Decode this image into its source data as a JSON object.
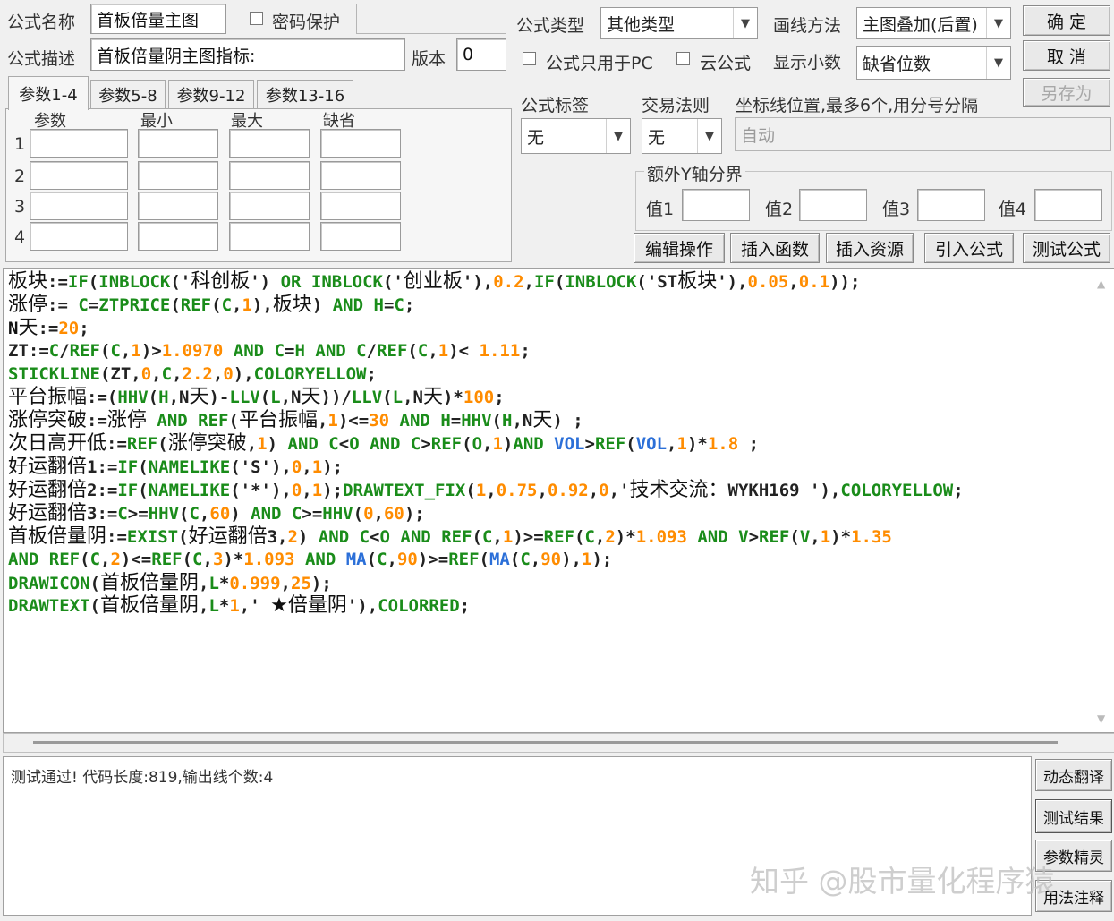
{
  "header": {
    "formula_name_label": "公式名称",
    "formula_name_value": "首板倍量主图",
    "password_protect_label": "密码保护",
    "formula_desc_label": "公式描述",
    "formula_desc_value": "首板倍量阴主图指标:",
    "version_label": "版本",
    "version_value": "0",
    "formula_type_label": "公式类型",
    "formula_type_value": "其他类型",
    "draw_method_label": "画线方法",
    "draw_method_value": "主图叠加(后置)",
    "pc_only_label": "公式只用于PC",
    "cloud_label": "云公式",
    "decimals_label": "显示小数",
    "decimals_value": "缺省位数",
    "tag_label": "公式标签",
    "tag_value": "无",
    "trade_rule_label": "交易法则",
    "trade_rule_value": "无",
    "axis_label": "坐标线位置,最多6个,用分号分隔",
    "axis_placeholder": "自动",
    "extra_y_label": "额外Y轴分界",
    "y_vals": [
      "值1",
      "值2",
      "值3",
      "值4"
    ]
  },
  "buttons": {
    "ok": "确  定",
    "cancel": "取  消",
    "save_as": "另存为",
    "edit_ops": "编辑操作",
    "insert_func": "插入函数",
    "insert_res": "插入资源",
    "import_formula": "引入公式",
    "test_formula": "测试公式",
    "dyn_translate": "动态翻译",
    "test_result": "测试结果",
    "param_wizard": "参数精灵",
    "usage_notes": "用法注释"
  },
  "params": {
    "tabs": [
      "参数1-4",
      "参数5-8",
      "参数9-12",
      "参数13-16"
    ],
    "columns": [
      "参数",
      "最小",
      "最大",
      "缺省"
    ],
    "rows": [
      "1",
      "2",
      "3",
      "4"
    ]
  },
  "code_lines": [
    [
      [
        "d",
        "板块"
      ],
      [
        "c",
        ":="
      ],
      [
        "k",
        "IF"
      ],
      [
        "c",
        "("
      ],
      [
        "k",
        "INBLOCK"
      ],
      [
        "c",
        "('"
      ],
      [
        "d",
        "科创板"
      ],
      [
        "c",
        "') "
      ],
      [
        "k",
        "OR"
      ],
      [
        "c",
        " "
      ],
      [
        "k",
        "INBLOCK"
      ],
      [
        "c",
        "('"
      ],
      [
        "d",
        "创业板"
      ],
      [
        "c",
        "'),"
      ],
      [
        "n",
        "0.2"
      ],
      [
        "c",
        ","
      ],
      [
        "k",
        "IF"
      ],
      [
        "c",
        "("
      ],
      [
        "k",
        "INBLOCK"
      ],
      [
        "c",
        "('ST"
      ],
      [
        "d",
        "板块"
      ],
      [
        "c",
        "'),"
      ],
      [
        "n",
        "0.05"
      ],
      [
        "c",
        ","
      ],
      [
        "n",
        "0.1"
      ],
      [
        "c",
        "));"
      ]
    ],
    [
      [
        "d",
        "涨停"
      ],
      [
        "c",
        ":= "
      ],
      [
        "k",
        "C"
      ],
      [
        "c",
        "="
      ],
      [
        "k",
        "ZTPRICE"
      ],
      [
        "c",
        "("
      ],
      [
        "k",
        "REF"
      ],
      [
        "c",
        "("
      ],
      [
        "k",
        "C"
      ],
      [
        "c",
        ","
      ],
      [
        "n",
        "1"
      ],
      [
        "c",
        "),"
      ],
      [
        "d",
        "板块"
      ],
      [
        "c",
        ") "
      ],
      [
        "k",
        "AND"
      ],
      [
        "c",
        " "
      ],
      [
        "k",
        "H"
      ],
      [
        "c",
        "="
      ],
      [
        "k",
        "C"
      ],
      [
        "c",
        ";"
      ]
    ],
    [
      [
        "s",
        "N"
      ],
      [
        "d",
        "天"
      ],
      [
        "c",
        ":="
      ],
      [
        "n",
        "20"
      ],
      [
        "c",
        ";"
      ]
    ],
    [
      [
        "c",
        "ZT:="
      ],
      [
        "k",
        "C"
      ],
      [
        "c",
        "/"
      ],
      [
        "k",
        "REF"
      ],
      [
        "c",
        "("
      ],
      [
        "k",
        "C"
      ],
      [
        "c",
        ","
      ],
      [
        "n",
        "1"
      ],
      [
        "c",
        ")>"
      ],
      [
        "n",
        "1.0970"
      ],
      [
        "c",
        " "
      ],
      [
        "k",
        "AND"
      ],
      [
        "c",
        " "
      ],
      [
        "k",
        "C"
      ],
      [
        "c",
        "="
      ],
      [
        "k",
        "H"
      ],
      [
        "c",
        " "
      ],
      [
        "k",
        "AND"
      ],
      [
        "c",
        " "
      ],
      [
        "k",
        "C"
      ],
      [
        "c",
        "/"
      ],
      [
        "k",
        "REF"
      ],
      [
        "c",
        "("
      ],
      [
        "k",
        "C"
      ],
      [
        "c",
        ","
      ],
      [
        "n",
        "1"
      ],
      [
        "c",
        ")< "
      ],
      [
        "n",
        "1.11"
      ],
      [
        "c",
        ";"
      ]
    ],
    [
      [
        "k",
        "STICKLINE"
      ],
      [
        "c",
        "(ZT,"
      ],
      [
        "n",
        "0"
      ],
      [
        "c",
        ","
      ],
      [
        "k",
        "C"
      ],
      [
        "c",
        ","
      ],
      [
        "n",
        "2.2"
      ],
      [
        "c",
        ","
      ],
      [
        "n",
        "0"
      ],
      [
        "c",
        "),"
      ],
      [
        "k",
        "COLORYELLOW"
      ],
      [
        "c",
        ";"
      ]
    ],
    [
      [
        "d",
        "平台振幅"
      ],
      [
        "c",
        ":=("
      ],
      [
        "k",
        "HHV"
      ],
      [
        "c",
        "("
      ],
      [
        "k",
        "H"
      ],
      [
        "c",
        ",N"
      ],
      [
        "d",
        "天"
      ],
      [
        "c",
        ")-"
      ],
      [
        "k",
        "LLV"
      ],
      [
        "c",
        "("
      ],
      [
        "k",
        "L"
      ],
      [
        "c",
        ",N"
      ],
      [
        "d",
        "天"
      ],
      [
        "c",
        "))/"
      ],
      [
        "k",
        "LLV"
      ],
      [
        "c",
        "("
      ],
      [
        "k",
        "L"
      ],
      [
        "c",
        ",N"
      ],
      [
        "d",
        "天"
      ],
      [
        "c",
        ")*"
      ],
      [
        "n",
        "100"
      ],
      [
        "c",
        ";"
      ]
    ],
    [
      [
        "d",
        "涨停突破"
      ],
      [
        "c",
        ":="
      ],
      [
        "d",
        "涨停"
      ],
      [
        "c",
        " "
      ],
      [
        "k",
        "AND"
      ],
      [
        "c",
        " "
      ],
      [
        "k",
        "REF"
      ],
      [
        "c",
        "("
      ],
      [
        "d",
        "平台振幅"
      ],
      [
        "c",
        ","
      ],
      [
        "n",
        "1"
      ],
      [
        "c",
        ")<="
      ],
      [
        "n",
        "30"
      ],
      [
        "c",
        " "
      ],
      [
        "k",
        "AND"
      ],
      [
        "c",
        " "
      ],
      [
        "k",
        "H"
      ],
      [
        "c",
        "="
      ],
      [
        "k",
        "HHV"
      ],
      [
        "c",
        "("
      ],
      [
        "k",
        "H"
      ],
      [
        "c",
        ",N"
      ],
      [
        "d",
        "天"
      ],
      [
        "c",
        ") ;"
      ]
    ],
    [
      [
        "d",
        "次日高开低"
      ],
      [
        "c",
        ":="
      ],
      [
        "k",
        "REF"
      ],
      [
        "c",
        "("
      ],
      [
        "d",
        "涨停突破"
      ],
      [
        "c",
        ","
      ],
      [
        "n",
        "1"
      ],
      [
        "c",
        ") "
      ],
      [
        "k",
        "AND"
      ],
      [
        "c",
        " "
      ],
      [
        "k",
        "C"
      ],
      [
        "c",
        "<"
      ],
      [
        "k",
        "O"
      ],
      [
        "c",
        " "
      ],
      [
        "k",
        "AND"
      ],
      [
        "c",
        " "
      ],
      [
        "k",
        "C"
      ],
      [
        "c",
        ">"
      ],
      [
        "k",
        "REF"
      ],
      [
        "c",
        "("
      ],
      [
        "k",
        "O"
      ],
      [
        "c",
        ","
      ],
      [
        "n",
        "1"
      ],
      [
        "c",
        ")"
      ],
      [
        "k",
        "AND"
      ],
      [
        "c",
        " "
      ],
      [
        "b",
        "VOL"
      ],
      [
        "c",
        ">"
      ],
      [
        "k",
        "REF"
      ],
      [
        "c",
        "("
      ],
      [
        "b",
        "VOL"
      ],
      [
        "c",
        ","
      ],
      [
        "n",
        "1"
      ],
      [
        "c",
        ")*"
      ],
      [
        "n",
        "1.8"
      ],
      [
        "c",
        " ;"
      ]
    ],
    [
      [
        "d",
        "好运翻倍"
      ],
      [
        "c",
        "1:="
      ],
      [
        "k",
        "IF"
      ],
      [
        "c",
        "("
      ],
      [
        "k",
        "NAMELIKE"
      ],
      [
        "c",
        "('S'),"
      ],
      [
        "n",
        "0"
      ],
      [
        "c",
        ","
      ],
      [
        "n",
        "1"
      ],
      [
        "c",
        ");"
      ]
    ],
    [
      [
        "d",
        "好运翻倍"
      ],
      [
        "c",
        "2:="
      ],
      [
        "k",
        "IF"
      ],
      [
        "c",
        "("
      ],
      [
        "k",
        "NAMELIKE"
      ],
      [
        "c",
        "('*'),"
      ],
      [
        "n",
        "0"
      ],
      [
        "c",
        ","
      ],
      [
        "n",
        "1"
      ],
      [
        "c",
        ");"
      ],
      [
        "k",
        "DRAWTEXT_FIX"
      ],
      [
        "c",
        "("
      ],
      [
        "n",
        "1"
      ],
      [
        "c",
        ","
      ],
      [
        "n",
        "0.75"
      ],
      [
        "c",
        ","
      ],
      [
        "n",
        "0.92"
      ],
      [
        "c",
        ","
      ],
      [
        "n",
        "0"
      ],
      [
        "c",
        ",'"
      ],
      [
        "d",
        "技术交流："
      ],
      [
        "c",
        "WYKH169 '),"
      ],
      [
        "k",
        "COLORYELLOW"
      ],
      [
        "c",
        ";"
      ]
    ],
    [
      [
        "d",
        "好运翻倍"
      ],
      [
        "c",
        "3:="
      ],
      [
        "k",
        "C"
      ],
      [
        "c",
        ">="
      ],
      [
        "k",
        "HHV"
      ],
      [
        "c",
        "("
      ],
      [
        "k",
        "C"
      ],
      [
        "c",
        ","
      ],
      [
        "n",
        "60"
      ],
      [
        "c",
        ") "
      ],
      [
        "k",
        "AND"
      ],
      [
        "c",
        " "
      ],
      [
        "k",
        "C"
      ],
      [
        "c",
        ">="
      ],
      [
        "k",
        "HHV"
      ],
      [
        "c",
        "("
      ],
      [
        "n",
        "0"
      ],
      [
        "c",
        ","
      ],
      [
        "n",
        "60"
      ],
      [
        "c",
        ");"
      ]
    ],
    [
      [
        "d",
        "首板倍量阴"
      ],
      [
        "c",
        ":="
      ],
      [
        "k",
        "EXIST"
      ],
      [
        "c",
        "("
      ],
      [
        "d",
        "好运翻倍"
      ],
      [
        "c",
        "3,"
      ],
      [
        "n",
        "2"
      ],
      [
        "c",
        ") "
      ],
      [
        "k",
        "AND"
      ],
      [
        "c",
        " "
      ],
      [
        "k",
        "C"
      ],
      [
        "c",
        "<"
      ],
      [
        "k",
        "O"
      ],
      [
        "c",
        " "
      ],
      [
        "k",
        "AND"
      ],
      [
        "c",
        " "
      ],
      [
        "k",
        "REF"
      ],
      [
        "c",
        "("
      ],
      [
        "k",
        "C"
      ],
      [
        "c",
        ","
      ],
      [
        "n",
        "1"
      ],
      [
        "c",
        ")>="
      ],
      [
        "k",
        "REF"
      ],
      [
        "c",
        "("
      ],
      [
        "k",
        "C"
      ],
      [
        "c",
        ","
      ],
      [
        "n",
        "2"
      ],
      [
        "c",
        ")*"
      ],
      [
        "n",
        "1.093"
      ],
      [
        "c",
        " "
      ],
      [
        "k",
        "AND"
      ],
      [
        "c",
        " "
      ],
      [
        "k",
        "V"
      ],
      [
        "c",
        ">"
      ],
      [
        "k",
        "REF"
      ],
      [
        "c",
        "("
      ],
      [
        "k",
        "V"
      ],
      [
        "c",
        ","
      ],
      [
        "n",
        "1"
      ],
      [
        "c",
        ")*"
      ],
      [
        "n",
        "1.35"
      ]
    ],
    [
      [
        "k",
        "AND"
      ],
      [
        "c",
        " "
      ],
      [
        "k",
        "REF"
      ],
      [
        "c",
        "("
      ],
      [
        "k",
        "C"
      ],
      [
        "c",
        ","
      ],
      [
        "n",
        "2"
      ],
      [
        "c",
        ")<="
      ],
      [
        "k",
        "REF"
      ],
      [
        "c",
        "("
      ],
      [
        "k",
        "C"
      ],
      [
        "c",
        ","
      ],
      [
        "n",
        "3"
      ],
      [
        "c",
        ")*"
      ],
      [
        "n",
        "1.093"
      ],
      [
        "c",
        " "
      ],
      [
        "k",
        "AND"
      ],
      [
        "c",
        " "
      ],
      [
        "b",
        "MA"
      ],
      [
        "c",
        "("
      ],
      [
        "k",
        "C"
      ],
      [
        "c",
        ","
      ],
      [
        "n",
        "90"
      ],
      [
        "c",
        ")>="
      ],
      [
        "k",
        "REF"
      ],
      [
        "c",
        "("
      ],
      [
        "b",
        "MA"
      ],
      [
        "c",
        "("
      ],
      [
        "k",
        "C"
      ],
      [
        "c",
        ","
      ],
      [
        "n",
        "90"
      ],
      [
        "c",
        "),"
      ],
      [
        "n",
        "1"
      ],
      [
        "c",
        ");"
      ]
    ],
    [
      [
        "k",
        "DRAWICON"
      ],
      [
        "c",
        "("
      ],
      [
        "d",
        "首板倍量阴"
      ],
      [
        "c",
        ","
      ],
      [
        "k",
        "L"
      ],
      [
        "c",
        "*"
      ],
      [
        "n",
        "0.999"
      ],
      [
        "c",
        ","
      ],
      [
        "n",
        "25"
      ],
      [
        "c",
        ");"
      ]
    ],
    [
      [
        "k",
        "DRAWTEXT"
      ],
      [
        "c",
        "("
      ],
      [
        "d",
        "首板倍量阴"
      ],
      [
        "c",
        ","
      ],
      [
        "k",
        "L"
      ],
      [
        "c",
        "*"
      ],
      [
        "n",
        "1"
      ],
      [
        "c",
        ",' "
      ],
      [
        "d",
        "★倍量阴"
      ],
      [
        "c",
        "'),"
      ],
      [
        "k",
        "COLORRED"
      ],
      [
        "c",
        ";"
      ]
    ]
  ],
  "status_text": "测试通过! 代码长度:819,输出线个数:4",
  "watermark": "知乎 @股市量化程序猿",
  "colors": {
    "keyword": "#1a8c1a",
    "number": "#ff8c00",
    "builtin": "#2b6fd8",
    "background": "#f0f0f0"
  }
}
